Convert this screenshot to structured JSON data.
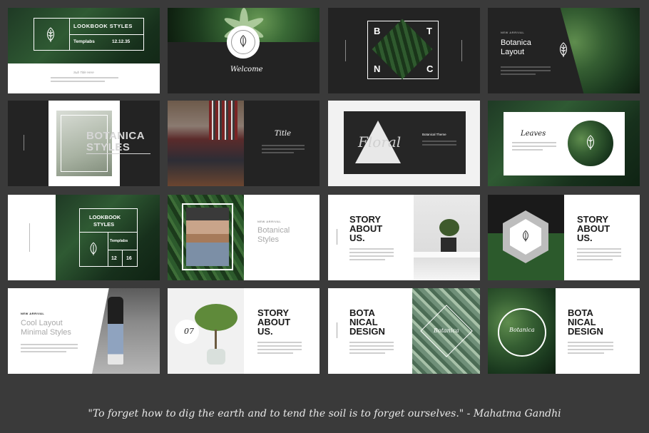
{
  "slides": {
    "s1": {
      "title": "LOOKBOOK STYLES",
      "brand": "Templabs",
      "date": "12.12.35",
      "caption": "Sub Title Here"
    },
    "s2": {
      "title": "Welcome"
    },
    "s3": {
      "l1": "B",
      "l2": "T",
      "l3": "N",
      "l4": "C"
    },
    "s4": {
      "tag": "NEW ARRIVAL",
      "title1": "Botanica",
      "title2": "Layout"
    },
    "s5": {
      "title1": "BOTANICA",
      "title2": "STYLES"
    },
    "s6": {
      "title": "Title"
    },
    "s7": {
      "title": "Floral",
      "subtitle": "Botanical Theme"
    },
    "s8": {
      "title": "Leaves"
    },
    "s9": {
      "title1": "LOOKBOOK",
      "title2": "STYLES",
      "brand": "Templabs",
      "n1": "12",
      "n2": "16"
    },
    "s10": {
      "tag": "NEW ARRIVAL",
      "title1": "Botanical",
      "title2": "Styles"
    },
    "s11": {
      "t1": "STORY",
      "t2": "ABOUT",
      "t3": "US."
    },
    "s12": {
      "t1": "STORY",
      "t2": "ABOUT",
      "t3": "US."
    },
    "s13": {
      "tag": "NEW ARRIVAL",
      "t1": "Cool Layout",
      "t2": "Minimal Styles"
    },
    "s14": {
      "num": "07",
      "t1": "STORY",
      "t2": "ABOUT",
      "t3": "US."
    },
    "s15": {
      "t1": "BOTA",
      "t2": "NICAL",
      "t3": "DESIGN",
      "script": "Botanica"
    },
    "s16": {
      "script": "Botanica",
      "t1": "BOTA",
      "t2": "NICAL",
      "t3": "DESIGN"
    }
  },
  "quote": "\"To forget how to dig the earth and to tend the soil is to forget ourselves.\" - Mahatma Gandhi",
  "colors": {
    "background": "#3a3a3a",
    "dark_slide": "#232323",
    "accent_green": "#2f5a33"
  }
}
